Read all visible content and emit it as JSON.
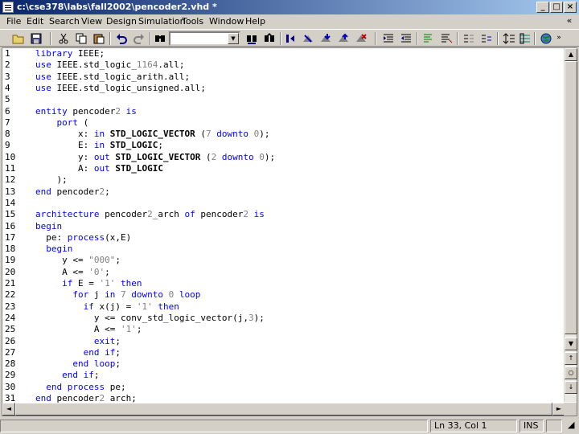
{
  "window": {
    "title": "c:\\cse378\\labs\\fall2002\\pencoder2.vhd *",
    "buttons": {
      "minimize": "_",
      "maximize": "□",
      "close": "×"
    }
  },
  "menu": {
    "items": [
      "File",
      "Edit",
      "Search",
      "View",
      "Design",
      "Simulation",
      "Tools",
      "Window",
      "Help"
    ],
    "mdi_restore": "«"
  },
  "toolbar": {
    "find_value": "",
    "buttons": [
      "new-file",
      "save",
      "cut",
      "copy",
      "paste",
      "undo",
      "redo",
      "find",
      "find-in-files",
      "bookmark",
      "toggle-bookmark",
      "next-bookmark",
      "prev-bookmark",
      "clear-bookmarks",
      "indent",
      "outdent",
      "comment",
      "uncomment",
      "align",
      "format",
      "sort",
      "columns",
      "web"
    ]
  },
  "editor": {
    "lines": [
      {
        "num": "1",
        "text": "library IEEE;"
      },
      {
        "num": "2",
        "text": "use IEEE.std_logic_1164.all;"
      },
      {
        "num": "3",
        "text": "use IEEE.std_logic_arith.all;"
      },
      {
        "num": "4",
        "text": "use IEEE.std_logic_unsigned.all;"
      },
      {
        "num": "5",
        "text": ""
      },
      {
        "num": "6",
        "text": "entity pencoder2 is"
      },
      {
        "num": "7",
        "text": "    port ("
      },
      {
        "num": "8",
        "text": "        x: in STD_LOGIC_VECTOR (7 downto 0);"
      },
      {
        "num": "9",
        "text": "        E: in STD_LOGIC;"
      },
      {
        "num": "10",
        "text": "        y: out STD_LOGIC_VECTOR (2 downto 0);"
      },
      {
        "num": "11",
        "text": "        A: out STD_LOGIC"
      },
      {
        "num": "12",
        "text": "    );"
      },
      {
        "num": "13",
        "text": "end pencoder2;"
      },
      {
        "num": "14",
        "text": ""
      },
      {
        "num": "15",
        "text": "architecture pencoder2_arch of pencoder2 is"
      },
      {
        "num": "16",
        "text": "begin"
      },
      {
        "num": "17",
        "text": "  pe: process(x,E)"
      },
      {
        "num": "18",
        "text": "  begin"
      },
      {
        "num": "19",
        "text": "     y <= \"000\";"
      },
      {
        "num": "20",
        "text": "     A <= '0';"
      },
      {
        "num": "21",
        "text": "     if E = '1' then"
      },
      {
        "num": "22",
        "text": "       for j in 7 downto 0 loop"
      },
      {
        "num": "23",
        "text": "         if x(j) = '1' then"
      },
      {
        "num": "24",
        "text": "           y <= conv_std_logic_vector(j,3);"
      },
      {
        "num": "25",
        "text": "           A <= '1';"
      },
      {
        "num": "26",
        "text": "           exit;"
      },
      {
        "num": "27",
        "text": "         end if;"
      },
      {
        "num": "28",
        "text": "       end loop;"
      },
      {
        "num": "29",
        "text": "     end if;"
      },
      {
        "num": "30",
        "text": "  end process pe;"
      },
      {
        "num": "31",
        "text": "end pencoder2_arch;"
      }
    ],
    "keywords": [
      "library",
      "use",
      "entity",
      "is",
      "port",
      "in",
      "out",
      "downto",
      "end",
      "architecture",
      "of",
      "begin",
      "process",
      "if",
      "then",
      "for",
      "loop",
      "exit"
    ],
    "types": [
      "STD_LOGIC_VECTOR",
      "STD_LOGIC"
    ],
    "colors": {
      "keyword": "#0000ff",
      "literal": "#808080",
      "text": "#000000"
    }
  },
  "status": {
    "position": "Ln 33, Col 1",
    "mode": "INS"
  }
}
